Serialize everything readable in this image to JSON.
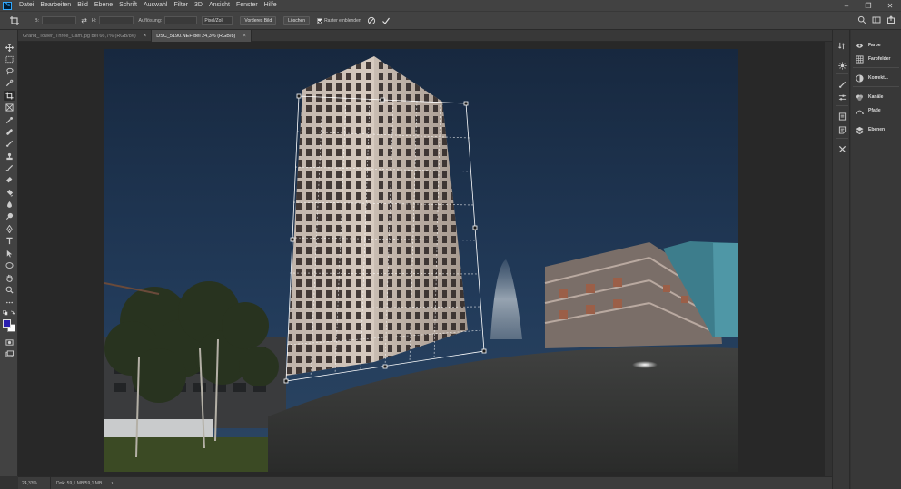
{
  "app": {
    "logo_text": "Ps"
  },
  "menu": [
    "Datei",
    "Bearbeiten",
    "Bild",
    "Ebene",
    "Schrift",
    "Auswahl",
    "Filter",
    "3D",
    "Ansicht",
    "Fenster",
    "Hilfe"
  ],
  "window_controls": {
    "minimize": "–",
    "restore": "❐",
    "close": "✕"
  },
  "options": {
    "width_label": "B:",
    "width_value": "",
    "height_label": "H:",
    "height_value": "",
    "resolution_label": "Auflösung:",
    "resolution_value": "",
    "unit_select": "Pixel/Zoll",
    "front_image_button": "Vorderes Bild",
    "clear_button": "Löschen",
    "grid_checkbox_label": "Raster einblenden",
    "grid_checked": true
  },
  "tabs": [
    {
      "label": "Grand_Tower_Three_Cam.jpg bei 66,7% (RGB/8#)",
      "close": "×",
      "active": false
    },
    {
      "label": "DSC_5190.NEF bei 24,3% (RGB/8)",
      "close": "×",
      "active": true
    }
  ],
  "tools": [
    "move-icon",
    "marquee-icon",
    "lasso-icon",
    "quick-select-icon",
    "crop-icon",
    "frame-icon",
    "eyedropper-icon",
    "healing-brush-icon",
    "brush-icon",
    "clone-stamp-icon",
    "history-brush-icon",
    "eraser-icon",
    "gradient-icon",
    "blur-icon",
    "dodge-icon",
    "pen-icon",
    "type-icon",
    "path-select-icon",
    "ellipse-icon",
    "hand-icon",
    "zoom-icon",
    "more-tools-icon"
  ],
  "colors": {
    "foreground": "#2a1eb0",
    "background": "#ffffff",
    "accent": "#31a8ff"
  },
  "status": {
    "zoom": "24,33%",
    "doc_info": "Dok: 59,1 MB/59,1 MB",
    "arrow": "›"
  },
  "panels": [
    {
      "icon": "color-wheel-icon",
      "label": "Farbe"
    },
    {
      "icon": "swatches-icon",
      "label": "Farbfelder"
    },
    {
      "icon": "adjustments-icon",
      "label": "Korrekt..."
    },
    {
      "icon": "channels-icon",
      "label": "Kanäle"
    },
    {
      "icon": "paths-icon",
      "label": "Pfade"
    },
    {
      "icon": "layers-icon",
      "label": "Ebenen"
    }
  ]
}
